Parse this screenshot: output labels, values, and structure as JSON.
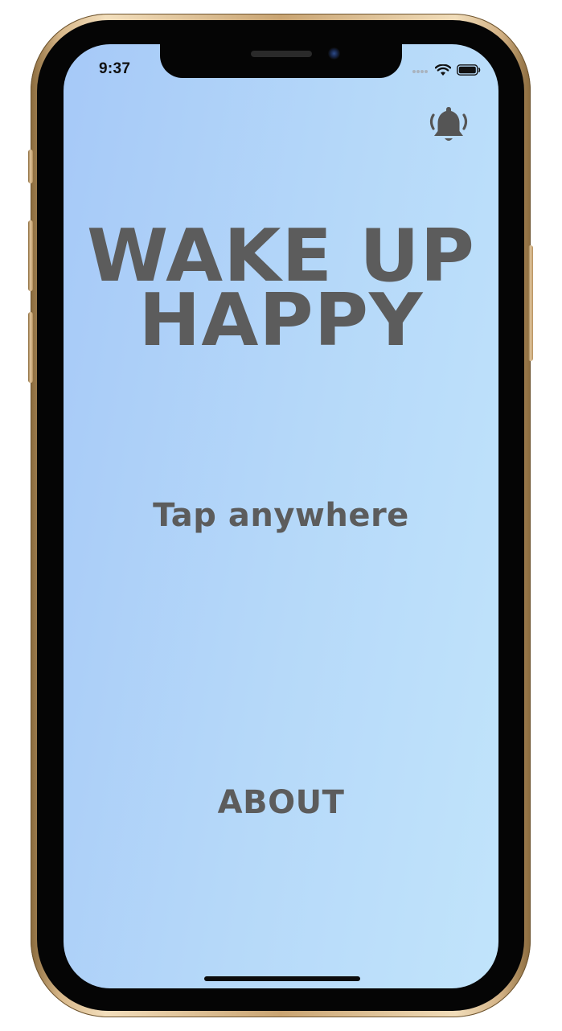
{
  "status_bar": {
    "time": "9:37"
  },
  "icons": {
    "alarm": "bell-icon",
    "signal": "cellular-signal-icon",
    "wifi": "wifi-icon",
    "battery": "battery-icon"
  },
  "main": {
    "title_line1": "WAKE UP",
    "title_line2": "HAPPY",
    "tap_label": "Tap anywhere",
    "about_label": "ABOUT"
  },
  "colors": {
    "text": "#5c5c5c",
    "background_start": "#a6c9f8",
    "background_end": "#c1e4fb"
  }
}
